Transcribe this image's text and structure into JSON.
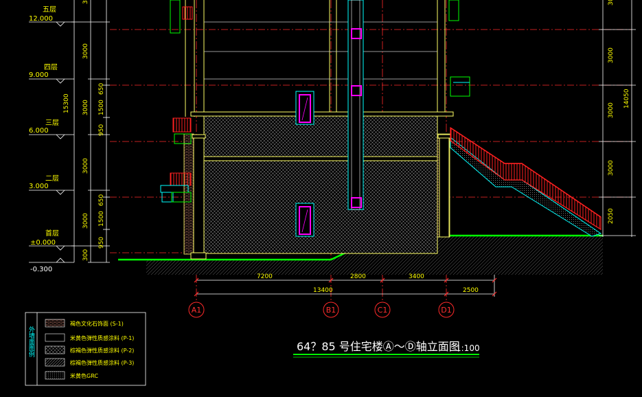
{
  "levels": [
    {
      "name": "五层",
      "elev": "12.000"
    },
    {
      "name": "四层",
      "elev": "9.000"
    },
    {
      "name": "三层",
      "elev": "6.000"
    },
    {
      "name": "二层",
      "elev": "3.000"
    },
    {
      "name": "首层",
      "elev": "±0.000"
    }
  ],
  "ground_elev": "-0.300",
  "left_dims": {
    "total": "15300",
    "segments": [
      "3000",
      "3000",
      "650",
      "1500",
      "950",
      "3000",
      "650",
      "1500",
      "950",
      "300"
    ]
  },
  "right_dims": {
    "total": "14050",
    "segments": [
      "3000",
      "3000",
      "3000",
      "3000",
      "2050"
    ]
  },
  "bottom_dims": {
    "segments": [
      "7200",
      "2800",
      "3400",
      "2500"
    ],
    "total": "13400"
  },
  "grid_axes": [
    "A1",
    "B1",
    "C1",
    "D1"
  ],
  "legend": {
    "title": "外墙面图例",
    "items": [
      {
        "label": "褐色文化石饰面 (S-1)",
        "pattern": "brick"
      },
      {
        "label": "米黄色弹性质感涂料 (P-1)",
        "pattern": "plain"
      },
      {
        "label": "棕褐色弹性质感涂料 (P-2)",
        "pattern": "cross"
      },
      {
        "label": "棕褐色弹性质感涂料 (P-3)",
        "pattern": "diag"
      },
      {
        "label": "米黄色GRC",
        "pattern": "dots"
      }
    ]
  },
  "drawing_title": "64？85 号住宅楼Ⓐ～Ⓓ轴立面图",
  "scale": "1:100",
  "colors": {
    "background": "#000000",
    "axis": "#ff2a2a",
    "wall": "#ffff66",
    "text": "#ffff00",
    "cyan": "#00ffff",
    "green": "#00ff00",
    "magenta": "#ff00ff",
    "rail": "#ff2020"
  }
}
